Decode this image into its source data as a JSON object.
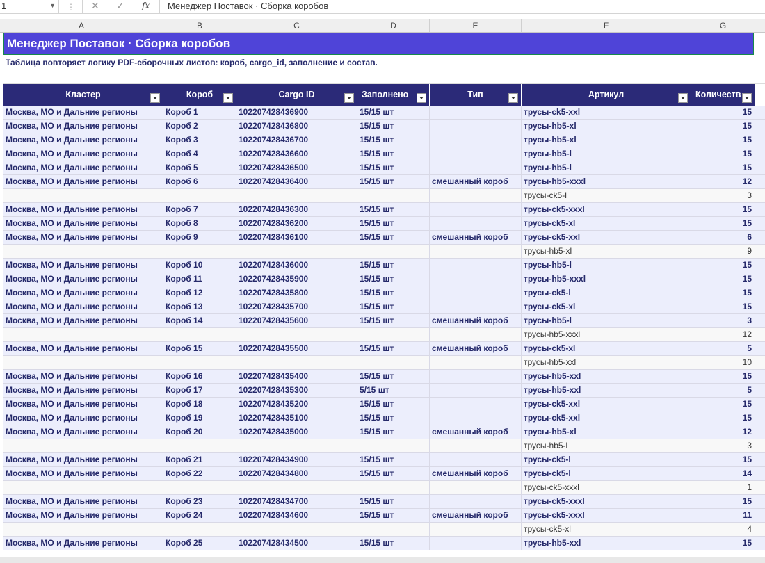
{
  "formula_bar": {
    "name_box": "1",
    "cancel_icon": "✕",
    "confirm_icon": "✓",
    "fx_label": "fx",
    "content": "Менеджер Поставок · Сборка коробов"
  },
  "columns": [
    "A",
    "B",
    "C",
    "D",
    "E",
    "F",
    "G"
  ],
  "sheet": {
    "title": "Менеджер Поставок · Сборка коробов",
    "subtitle": "Таблица повторяет логику PDF-сборочных листов: короб, cargo_id, заполнение и состав.",
    "headers": [
      "Кластер",
      "Короб",
      "Cargo ID",
      "Заполнено",
      "Тип",
      "Артикул",
      "Количество"
    ],
    "rows": [
      {
        "kind": "main",
        "cluster": "Москва, МО и Дальние регионы",
        "box": "Короб 1",
        "cargo": "102207428436900",
        "fill": "15/15 шт",
        "type": "",
        "article": "трусы-ck5-xxl",
        "qty": "15"
      },
      {
        "kind": "main",
        "cluster": "Москва, МО и Дальние регионы",
        "box": "Короб 2",
        "cargo": "102207428436800",
        "fill": "15/15 шт",
        "type": "",
        "article": "трусы-hb5-xl",
        "qty": "15"
      },
      {
        "kind": "main",
        "cluster": "Москва, МО и Дальние регионы",
        "box": "Короб 3",
        "cargo": "102207428436700",
        "fill": "15/15 шт",
        "type": "",
        "article": "трусы-hb5-xl",
        "qty": "15"
      },
      {
        "kind": "main",
        "cluster": "Москва, МО и Дальние регионы",
        "box": "Короб 4",
        "cargo": "102207428436600",
        "fill": "15/15 шт",
        "type": "",
        "article": "трусы-hb5-l",
        "qty": "15"
      },
      {
        "kind": "main",
        "cluster": "Москва, МО и Дальние регионы",
        "box": "Короб 5",
        "cargo": "102207428436500",
        "fill": "15/15 шт",
        "type": "",
        "article": "трусы-hb5-l",
        "qty": "15"
      },
      {
        "kind": "main",
        "cluster": "Москва, МО и Дальние регионы",
        "box": "Короб 6",
        "cargo": "102207428436400",
        "fill": "15/15 шт",
        "type": "смешанный короб",
        "article": "трусы-hb5-xxxl",
        "qty": "12"
      },
      {
        "kind": "sub",
        "cluster": "",
        "box": "",
        "cargo": "",
        "fill": "",
        "type": "",
        "article": "трусы-ck5-l",
        "qty": "3"
      },
      {
        "kind": "main",
        "cluster": "Москва, МО и Дальние регионы",
        "box": "Короб 7",
        "cargo": "102207428436300",
        "fill": "15/15 шт",
        "type": "",
        "article": "трусы-ck5-xxxl",
        "qty": "15"
      },
      {
        "kind": "main",
        "cluster": "Москва, МО и Дальние регионы",
        "box": "Короб 8",
        "cargo": "102207428436200",
        "fill": "15/15 шт",
        "type": "",
        "article": "трусы-ck5-xl",
        "qty": "15"
      },
      {
        "kind": "main",
        "cluster": "Москва, МО и Дальние регионы",
        "box": "Короб 9",
        "cargo": "102207428436100",
        "fill": "15/15 шт",
        "type": "смешанный короб",
        "article": "трусы-ck5-xxl",
        "qty": "6"
      },
      {
        "kind": "sub",
        "cluster": "",
        "box": "",
        "cargo": "",
        "fill": "",
        "type": "",
        "article": "трусы-hb5-xl",
        "qty": "9"
      },
      {
        "kind": "main",
        "cluster": "Москва, МО и Дальние регионы",
        "box": "Короб 10",
        "cargo": "102207428436000",
        "fill": "15/15 шт",
        "type": "",
        "article": "трусы-hb5-l",
        "qty": "15"
      },
      {
        "kind": "main",
        "cluster": "Москва, МО и Дальние регионы",
        "box": "Короб 11",
        "cargo": "102207428435900",
        "fill": "15/15 шт",
        "type": "",
        "article": "трусы-hb5-xxxl",
        "qty": "15"
      },
      {
        "kind": "main",
        "cluster": "Москва, МО и Дальние регионы",
        "box": "Короб 12",
        "cargo": "102207428435800",
        "fill": "15/15 шт",
        "type": "",
        "article": "трусы-ck5-l",
        "qty": "15"
      },
      {
        "kind": "main",
        "cluster": "Москва, МО и Дальние регионы",
        "box": "Короб 13",
        "cargo": "102207428435700",
        "fill": "15/15 шт",
        "type": "",
        "article": "трусы-ck5-xl",
        "qty": "15"
      },
      {
        "kind": "main",
        "cluster": "Москва, МО и Дальние регионы",
        "box": "Короб 14",
        "cargo": "102207428435600",
        "fill": "15/15 шт",
        "type": "смешанный короб",
        "article": "трусы-hb5-l",
        "qty": "3"
      },
      {
        "kind": "sub",
        "cluster": "",
        "box": "",
        "cargo": "",
        "fill": "",
        "type": "",
        "article": "трусы-hb5-xxxl",
        "qty": "12"
      },
      {
        "kind": "main",
        "cluster": "Москва, МО и Дальние регионы",
        "box": "Короб 15",
        "cargo": "102207428435500",
        "fill": "15/15 шт",
        "type": "смешанный короб",
        "article": "трусы-ck5-xl",
        "qty": "5"
      },
      {
        "kind": "sub",
        "cluster": "",
        "box": "",
        "cargo": "",
        "fill": "",
        "type": "",
        "article": "трусы-hb5-xxl",
        "qty": "10"
      },
      {
        "kind": "main",
        "cluster": "Москва, МО и Дальние регионы",
        "box": "Короб 16",
        "cargo": "102207428435400",
        "fill": "15/15 шт",
        "type": "",
        "article": "трусы-hb5-xxl",
        "qty": "15"
      },
      {
        "kind": "main",
        "cluster": "Москва, МО и Дальние регионы",
        "box": "Короб 17",
        "cargo": "102207428435300",
        "fill": "5/15 шт",
        "type": "",
        "article": "трусы-hb5-xxl",
        "qty": "5"
      },
      {
        "kind": "main",
        "cluster": "Москва, МО и Дальние регионы",
        "box": "Короб 18",
        "cargo": "102207428435200",
        "fill": "15/15 шт",
        "type": "",
        "article": "трусы-ck5-xxl",
        "qty": "15"
      },
      {
        "kind": "main",
        "cluster": "Москва, МО и Дальние регионы",
        "box": "Короб 19",
        "cargo": "102207428435100",
        "fill": "15/15 шт",
        "type": "",
        "article": "трусы-ck5-xxl",
        "qty": "15"
      },
      {
        "kind": "main",
        "cluster": "Москва, МО и Дальние регионы",
        "box": "Короб 20",
        "cargo": "102207428435000",
        "fill": "15/15 шт",
        "type": "смешанный короб",
        "article": "трусы-hb5-xl",
        "qty": "12"
      },
      {
        "kind": "sub",
        "cluster": "",
        "box": "",
        "cargo": "",
        "fill": "",
        "type": "",
        "article": "трусы-hb5-l",
        "qty": "3"
      },
      {
        "kind": "main",
        "cluster": "Москва, МО и Дальние регионы",
        "box": "Короб 21",
        "cargo": "102207428434900",
        "fill": "15/15 шт",
        "type": "",
        "article": "трусы-ck5-l",
        "qty": "15"
      },
      {
        "kind": "main",
        "cluster": "Москва, МО и Дальние регионы",
        "box": "Короб 22",
        "cargo": "102207428434800",
        "fill": "15/15 шт",
        "type": "смешанный короб",
        "article": "трусы-ck5-l",
        "qty": "14"
      },
      {
        "kind": "sub",
        "cluster": "",
        "box": "",
        "cargo": "",
        "fill": "",
        "type": "",
        "article": "трусы-ck5-xxxl",
        "qty": "1"
      },
      {
        "kind": "main",
        "cluster": "Москва, МО и Дальние регионы",
        "box": "Короб 23",
        "cargo": "102207428434700",
        "fill": "15/15 шт",
        "type": "",
        "article": "трусы-ck5-xxxl",
        "qty": "15"
      },
      {
        "kind": "main",
        "cluster": "Москва, МО и Дальние регионы",
        "box": "Короб 24",
        "cargo": "102207428434600",
        "fill": "15/15 шт",
        "type": "смешанный короб",
        "article": "трусы-ck5-xxxl",
        "qty": "11"
      },
      {
        "kind": "sub",
        "cluster": "",
        "box": "",
        "cargo": "",
        "fill": "",
        "type": "",
        "article": "трусы-ck5-xl",
        "qty": "4"
      },
      {
        "kind": "main",
        "cluster": "Москва, МО и Дальние регионы",
        "box": "Короб 25",
        "cargo": "102207428434500",
        "fill": "15/15 шт",
        "type": "",
        "article": "трусы-hb5-xxl",
        "qty": "15"
      }
    ]
  }
}
